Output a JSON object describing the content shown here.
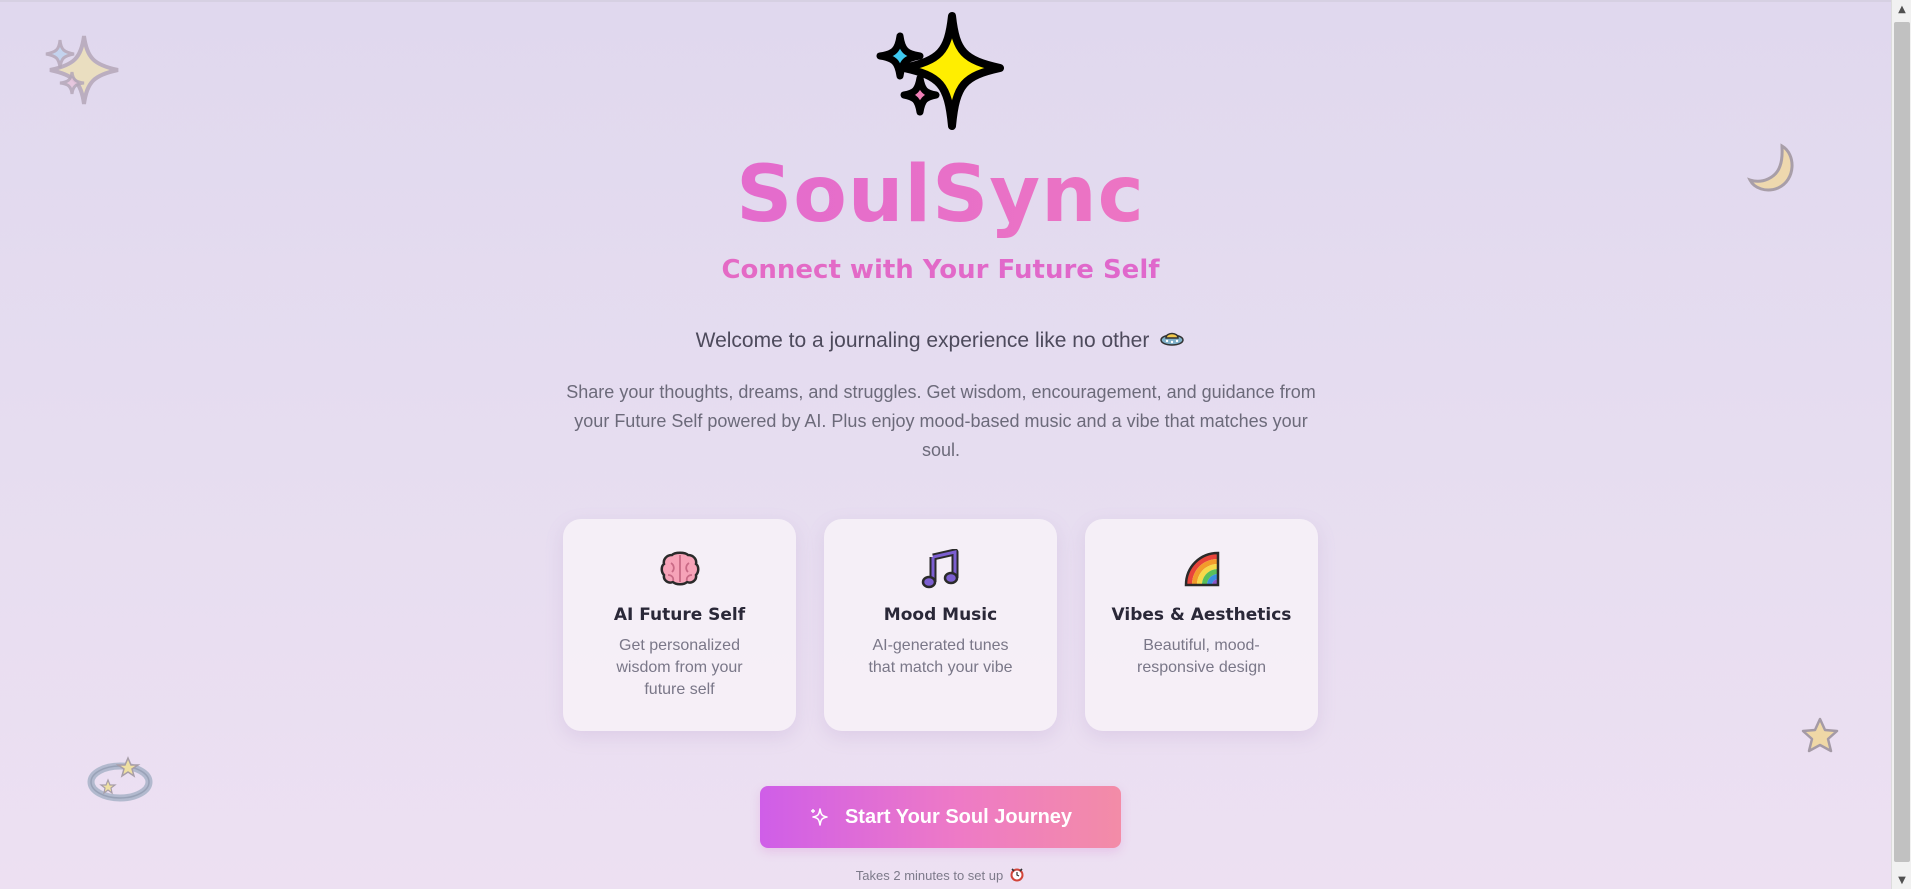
{
  "hero": {
    "icon": "sparkles-icon",
    "title": "SoulSync",
    "subtitle": "Connect with Your Future Self"
  },
  "intro": {
    "welcome": "Welcome to a journaling experience like no other",
    "welcome_icon": "flying-saucer-icon",
    "description": "Share your thoughts, dreams, and struggles. Get wisdom, encouragement, and guidance from your Future Self powered by AI. Plus enjoy mood-based music and a vibe that matches your soul."
  },
  "features": [
    {
      "icon": "brain-icon",
      "title": "AI Future Self",
      "text": "Get personalized wisdom from your future self"
    },
    {
      "icon": "music-notes-icon",
      "title": "Mood Music",
      "text": "AI-generated tunes that match your vibe"
    },
    {
      "icon": "rainbow-icon",
      "title": "Vibes & Aesthetics",
      "text": "Beautiful, mood-responsive design"
    }
  ],
  "cta": {
    "label": "Start Your Soul Journey",
    "icon": "sparkle-icon"
  },
  "footnote": {
    "text": "Takes 2 minutes to set up",
    "icon": "alarm-clock-icon"
  },
  "colors": {
    "title_gradient": [
      "#d35be0",
      "#f184b0"
    ],
    "button_gradient": [
      "#cf5ee8",
      "#f38ca7"
    ],
    "background": "#e0d8ee"
  }
}
